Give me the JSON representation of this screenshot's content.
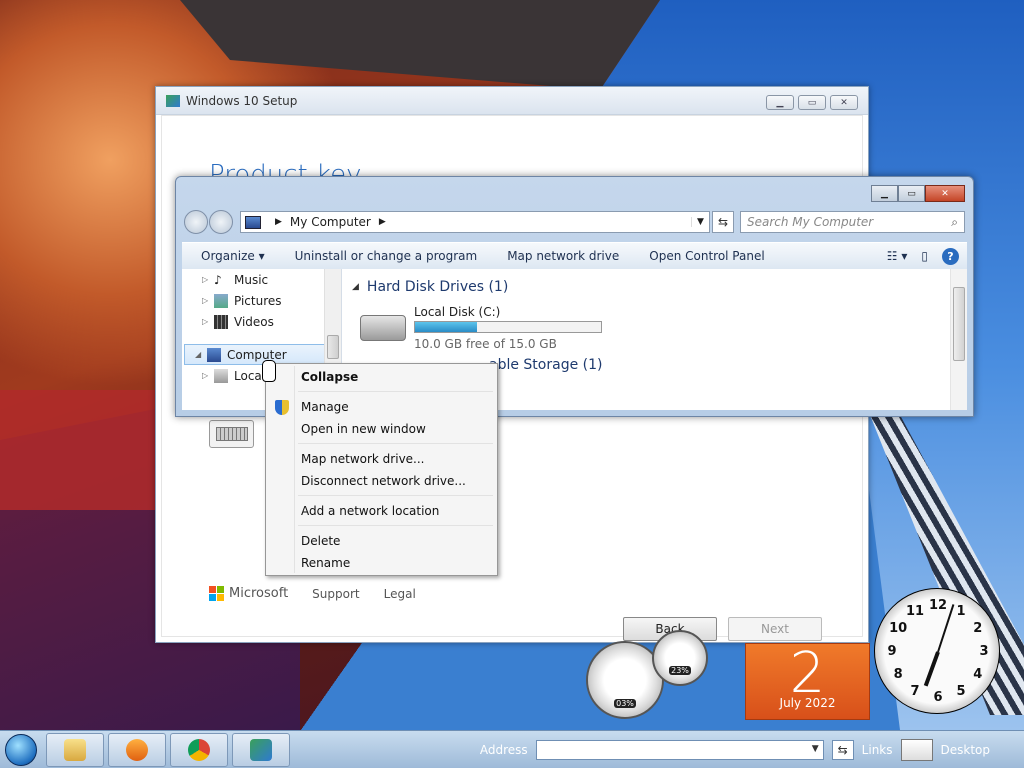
{
  "setup": {
    "title": "Windows 10 Setup",
    "heading": "Product key",
    "microsoft": "Microsoft",
    "support": "Support",
    "legal": "Legal",
    "back": "Back",
    "next": "Next"
  },
  "explorer": {
    "breadcrumb": "My Computer",
    "search_placeholder": "Search My Computer",
    "toolbar": [
      "Organize",
      "Uninstall or change a program",
      "Map network drive",
      "Open Control Panel"
    ],
    "nav": [
      "Music",
      "Pictures",
      "Videos",
      "Computer",
      "Local"
    ],
    "group_hdd": "Hard Disk Drives (1)",
    "disk_name": "Local Disk (C:)",
    "disk_free": "10.0 GB free of 15.0 GB",
    "disk_used_fraction": 0.333,
    "group_removable": "able Storage (1)"
  },
  "context_menu": {
    "items": [
      "Collapse",
      "Manage",
      "Open in new window",
      "Map network drive...",
      "Disconnect network drive...",
      "Add a network location",
      "Delete",
      "Rename"
    ]
  },
  "gadgets": {
    "cpu": "03%",
    "mem": "23%",
    "day": "2",
    "month_year": "July 2022",
    "clock_numbers": [
      "12",
      "1",
      "2",
      "3",
      "4",
      "5",
      "6",
      "7",
      "8",
      "9",
      "10",
      "11"
    ]
  },
  "taskbar": {
    "address_label": "Address",
    "links": "Links",
    "desktop": "Desktop"
  },
  "colors": {
    "accent": "#2a6cbf",
    "calendar": "#e8651f",
    "disk_fill": "#2a8cc6"
  }
}
